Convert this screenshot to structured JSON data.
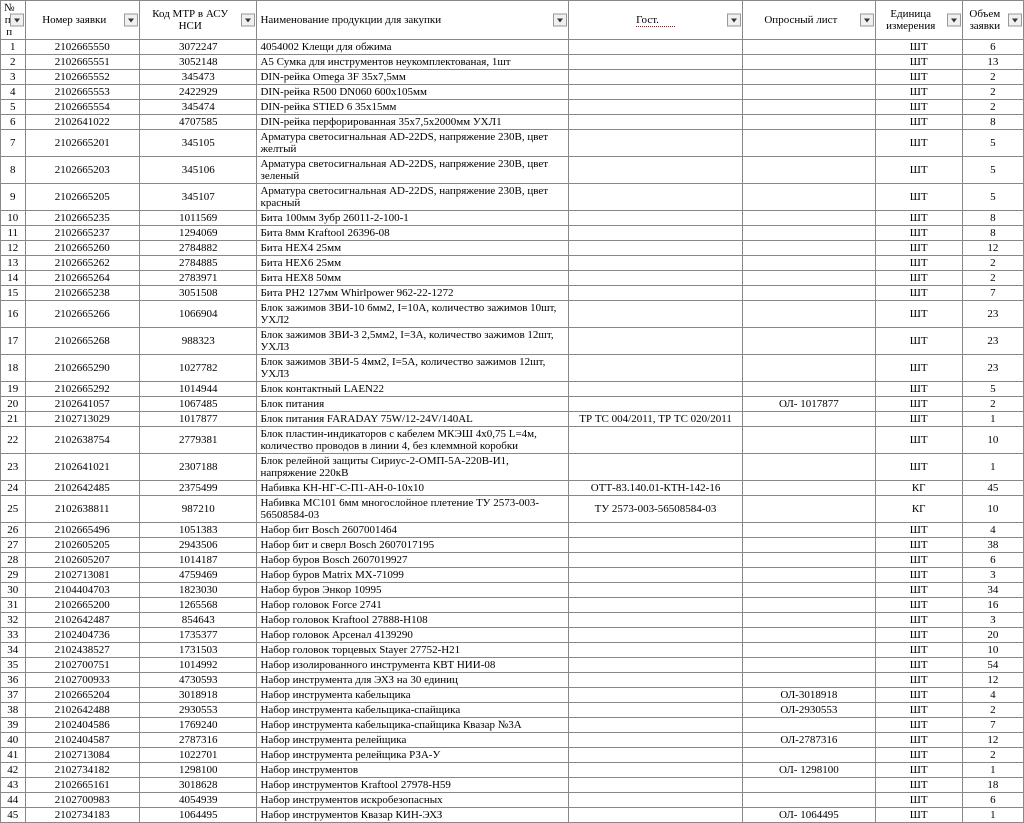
{
  "headers": {
    "num": "№ п/п",
    "request": "Номер заявки",
    "code": "Код МТР в АСУ НСИ",
    "name": "Наименование продукции для закупки",
    "gost": "Гост.",
    "opros": "Опросный лист",
    "unit": "Единица измерения",
    "volume": "Объем заявки"
  },
  "rows": [
    {
      "num": "1",
      "req": "2102665550",
      "code": "3072247",
      "name": "4054002 Клещи для обжима",
      "gost": "",
      "opros": "",
      "unit": "ШТ",
      "vol": "6"
    },
    {
      "num": "2",
      "req": "2102665551",
      "code": "3052148",
      "name": "A5 Сумка для инструментов неукомплектованая, 1шт",
      "gost": "",
      "opros": "",
      "unit": "ШТ",
      "vol": "13"
    },
    {
      "num": "3",
      "req": "2102665552",
      "code": "345473",
      "name": "DIN-рейка Omega 3F 35x7,5мм",
      "gost": "",
      "opros": "",
      "unit": "ШТ",
      "vol": "2"
    },
    {
      "num": "4",
      "req": "2102665553",
      "code": "2422929",
      "name": "DIN-рейка R500 DN060 600x105мм",
      "gost": "",
      "opros": "",
      "unit": "ШТ",
      "vol": "2"
    },
    {
      "num": "5",
      "req": "2102665554",
      "code": "345474",
      "name": "DIN-рейка STIED 6 35x15мм",
      "gost": "",
      "opros": "",
      "unit": "ШТ",
      "vol": "2"
    },
    {
      "num": "6",
      "req": "2102641022",
      "code": "4707585",
      "name": "DIN-рейка перфорированная 35x7,5x2000мм УХЛ1",
      "gost": "",
      "opros": "",
      "unit": "ШТ",
      "vol": "8"
    },
    {
      "num": "7",
      "req": "2102665201",
      "code": "345105",
      "name": "Арматура светосигнальная AD-22DS, напряжение 230В, цвет желтый",
      "gost": "",
      "opros": "",
      "unit": "ШТ",
      "vol": "5"
    },
    {
      "num": "8",
      "req": "2102665203",
      "code": "345106",
      "name": "Арматура светосигнальная AD-22DS, напряжение 230В, цвет зеленый",
      "gost": "",
      "opros": "",
      "unit": "ШТ",
      "vol": "5"
    },
    {
      "num": "9",
      "req": "2102665205",
      "code": "345107",
      "name": "Арматура светосигнальная AD-22DS, напряжение 230В, цвет красный",
      "gost": "",
      "opros": "",
      "unit": "ШТ",
      "vol": "5"
    },
    {
      "num": "10",
      "req": "2102665235",
      "code": "1011569",
      "name": "Бита 100мм Зубр 26011-2-100-1",
      "gost": "",
      "opros": "",
      "unit": "ШТ",
      "vol": "8"
    },
    {
      "num": "11",
      "req": "2102665237",
      "code": "1294069",
      "name": "Бита 8мм Kraftool 26396-08",
      "gost": "",
      "opros": "",
      "unit": "ШТ",
      "vol": "8"
    },
    {
      "num": "12",
      "req": "2102665260",
      "code": "2784882",
      "name": "Бита HEX4 25мм",
      "gost": "",
      "opros": "",
      "unit": "ШТ",
      "vol": "12"
    },
    {
      "num": "13",
      "req": "2102665262",
      "code": "2784885",
      "name": "Бита HEX6 25мм",
      "gost": "",
      "opros": "",
      "unit": "ШТ",
      "vol": "2"
    },
    {
      "num": "14",
      "req": "2102665264",
      "code": "2783971",
      "name": "Бита HEX8 50мм",
      "gost": "",
      "opros": "",
      "unit": "ШТ",
      "vol": "2"
    },
    {
      "num": "15",
      "req": "2102665238",
      "code": "3051508",
      "name": "Бита PH2 127мм Whirlpower 962-22-1272",
      "gost": "",
      "opros": "",
      "unit": "ШТ",
      "vol": "7"
    },
    {
      "num": "16",
      "req": "2102665266",
      "code": "1066904",
      "name": "Блок зажимов ЗВИ-10 6мм2, I=10А, количество зажимов 10шт, УХЛ2",
      "gost": "",
      "opros": "",
      "unit": "ШТ",
      "vol": "23"
    },
    {
      "num": "17",
      "req": "2102665268",
      "code": "988323",
      "name": "Блок зажимов ЗВИ-3 2,5мм2, I=3А, количество зажимов 12шт, УХЛ3",
      "gost": "",
      "opros": "",
      "unit": "ШТ",
      "vol": "23"
    },
    {
      "num": "18",
      "req": "2102665290",
      "code": "1027782",
      "name": "Блок зажимов ЗВИ-5 4мм2, I=5А, количество зажимов 12шт, УХЛ3",
      "gost": "",
      "opros": "",
      "unit": "ШТ",
      "vol": "23"
    },
    {
      "num": "19",
      "req": "2102665292",
      "code": "1014944",
      "name": "Блок контактный LAEN22",
      "gost": "",
      "opros": "",
      "unit": "ШТ",
      "vol": "5"
    },
    {
      "num": "20",
      "req": "2102641057",
      "code": "1067485",
      "name": "Блок питания",
      "gost": "",
      "opros": "ОЛ- 1017877",
      "unit": "ШТ",
      "vol": "2"
    },
    {
      "num": "21",
      "req": "2102713029",
      "code": "1017877",
      "name": "Блок питания FARADAY 75W/12-24V/140AL",
      "gost": "ТР ТС 004/2011, ТР ТС 020/2011",
      "opros": "",
      "unit": "ШТ",
      "vol": "1"
    },
    {
      "num": "22",
      "req": "2102638754",
      "code": "2779381",
      "name": "Блок пластин-индикаторов с кабелем МКЭШ 4x0,75 L=4м, количество проводов в линии 4, без клеммной коробки",
      "gost": "",
      "opros": "",
      "unit": "ШТ",
      "vol": "10"
    },
    {
      "num": "23",
      "req": "2102641021",
      "code": "2307188",
      "name": "Блок релейной защиты Сириус-2-ОМП-5А-220В-И1, напряжение 220кВ",
      "gost": "",
      "opros": "",
      "unit": "ШТ",
      "vol": "1"
    },
    {
      "num": "24",
      "req": "2102642485",
      "code": "2375499",
      "name": "Набивка КН-НГ-С-П1-АН-0-10х10",
      "gost": "ОТТ-83.140.01-КТН-142-16",
      "opros": "",
      "unit": "КГ",
      "vol": "45"
    },
    {
      "num": "25",
      "req": "2102638811",
      "code": "987210",
      "name": "Набивка МС101 6мм многослойное плетение ТУ 2573-003-56508584-03",
      "gost": "ТУ 2573-003-56508584-03",
      "opros": "",
      "unit": "КГ",
      "vol": "10"
    },
    {
      "num": "26",
      "req": "2102665496",
      "code": "1051383",
      "name": "Набор бит Bosch 2607001464",
      "gost": "",
      "opros": "",
      "unit": "ШТ",
      "vol": "4"
    },
    {
      "num": "27",
      "req": "2102605205",
      "code": "2943506",
      "name": "Набор бит и сверл Bosch 2607017195",
      "gost": "",
      "opros": "",
      "unit": "ШТ",
      "vol": "38"
    },
    {
      "num": "28",
      "req": "2102605207",
      "code": "1014187",
      "name": "Набор буров Bosch 2607019927",
      "gost": "",
      "opros": "",
      "unit": "ШТ",
      "vol": "6"
    },
    {
      "num": "29",
      "req": "2102713081",
      "code": "4759469",
      "name": "Набор буров Matrix MX-71099",
      "gost": "",
      "opros": "",
      "unit": "ШТ",
      "vol": "3"
    },
    {
      "num": "30",
      "req": "2104404703",
      "code": "1823030",
      "name": "Набор буров Энкор 10995",
      "gost": "",
      "opros": "",
      "unit": "ШТ",
      "vol": "34"
    },
    {
      "num": "31",
      "req": "2102665200",
      "code": "1265568",
      "name": "Набор головок Force 2741",
      "gost": "",
      "opros": "",
      "unit": "ШТ",
      "vol": "16"
    },
    {
      "num": "32",
      "req": "2102642487",
      "code": "854643",
      "name": "Набор головок Kraftool 27888-H108",
      "gost": "",
      "opros": "",
      "unit": "ШТ",
      "vol": "3"
    },
    {
      "num": "33",
      "req": "2102404736",
      "code": "1735377",
      "name": "Набор головок Арсенал 4139290",
      "gost": "",
      "opros": "",
      "unit": "ШТ",
      "vol": "20"
    },
    {
      "num": "34",
      "req": "2102438527",
      "code": "1731503",
      "name": "Набор головок торцевых Stayer 27752-H21",
      "gost": "",
      "opros": "",
      "unit": "ШТ",
      "vol": "10"
    },
    {
      "num": "35",
      "req": "2102700751",
      "code": "1014992",
      "name": "Набор изолированного инструмента КВТ НИИ-08",
      "gost": "",
      "opros": "",
      "unit": "ШТ",
      "vol": "54"
    },
    {
      "num": "36",
      "req": "2102700933",
      "code": "4730593",
      "name": "Набор инструмента для ЭХЗ на 30 единиц",
      "gost": "",
      "opros": "",
      "unit": "ШТ",
      "vol": "12"
    },
    {
      "num": "37",
      "req": "2102665204",
      "code": "3018918",
      "name": "Набор инструмента кабельщика",
      "gost": "",
      "opros": "ОЛ-3018918",
      "unit": "ШТ",
      "vol": "4"
    },
    {
      "num": "38",
      "req": "2102642488",
      "code": "2930553",
      "name": "Набор инструмента кабельщика-спайщика",
      "gost": "",
      "opros": "ОЛ-2930553",
      "unit": "ШТ",
      "vol": "2"
    },
    {
      "num": "39",
      "req": "2102404586",
      "code": "1769240",
      "name": "Набор инструмента кабельщика-спайщика Квазар №3А",
      "gost": "",
      "opros": "",
      "unit": "ШТ",
      "vol": "7"
    },
    {
      "num": "40",
      "req": "2102404587",
      "code": "2787316",
      "name": "Набор инструмента релейщика",
      "gost": "",
      "opros": "ОЛ-2787316",
      "unit": "ШТ",
      "vol": "12"
    },
    {
      "num": "41",
      "req": "2102713084",
      "code": "1022701",
      "name": "Набор инструмента релейщика РЗА-У",
      "gost": "",
      "opros": "",
      "unit": "ШТ",
      "vol": "2"
    },
    {
      "num": "42",
      "req": "2102734182",
      "code": "1298100",
      "name": "Набор инструментов",
      "gost": "",
      "opros": "ОЛ- 1298100",
      "unit": "ШТ",
      "vol": "1"
    },
    {
      "num": "43",
      "req": "2102665161",
      "code": "3018628",
      "name": "Набор инструментов Kraftool 27978-H59",
      "gost": "",
      "opros": "",
      "unit": "ШТ",
      "vol": "18"
    },
    {
      "num": "44",
      "req": "2102700983",
      "code": "4054939",
      "name": "Набор инструментов искробезопасных",
      "gost": "",
      "opros": "",
      "unit": "ШТ",
      "vol": "6"
    },
    {
      "num": "45",
      "req": "2102734183",
      "code": "1064495",
      "name": "Набор инструментов Квазар КИН-ЭХЗ",
      "gost": "",
      "opros": "ОЛ- 1064495",
      "unit": "ШТ",
      "vol": "1"
    }
  ]
}
